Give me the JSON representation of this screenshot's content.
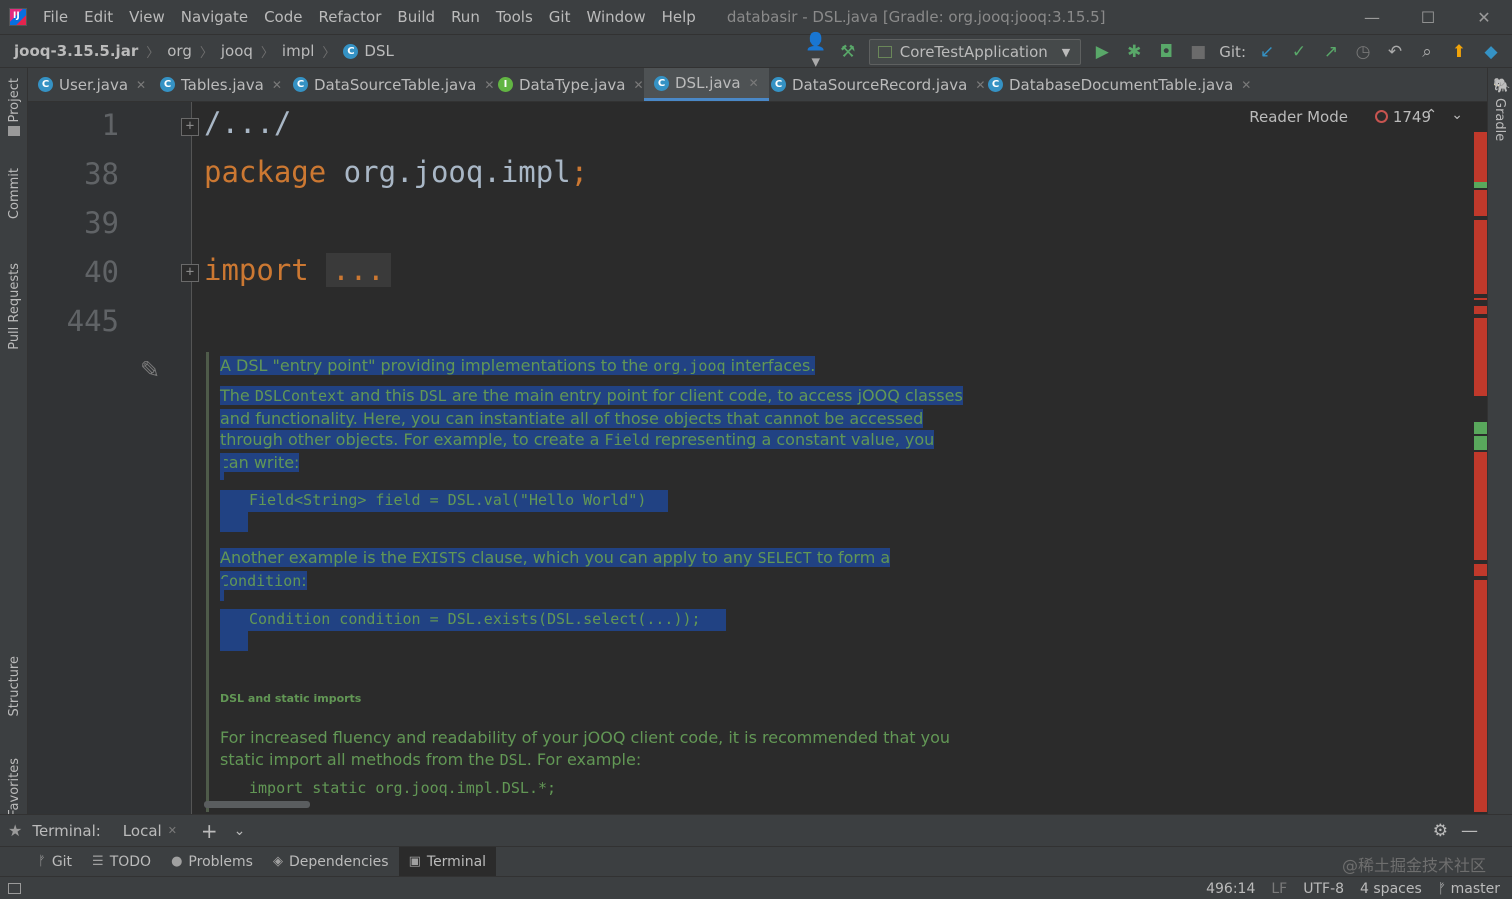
{
  "window": {
    "title": "databasir - DSL.java [Gradle: org.jooq:jooq:3.15.5]",
    "menu": [
      "File",
      "Edit",
      "View",
      "Navigate",
      "Code",
      "Refactor",
      "Build",
      "Run",
      "Tools",
      "Git",
      "Window",
      "Help"
    ],
    "controls": {
      "minimize": "—",
      "maximize": "☐",
      "close": "✕"
    }
  },
  "breadcrumbs": [
    "jooq-3.15.5.jar",
    "org",
    "jooq",
    "impl",
    "DSL"
  ],
  "toolbar": {
    "run_config": "CoreTestApplication",
    "git_label": "Git:"
  },
  "left_tool_windows": [
    "Project",
    "Commit",
    "Pull Requests",
    "Structure",
    "Favorites"
  ],
  "right_tool_windows": [
    "Gradle"
  ],
  "tabs": [
    {
      "label": "User.java",
      "badge": "C"
    },
    {
      "label": "Tables.java",
      "badge": "C"
    },
    {
      "label": "DataSourceTable.java",
      "badge": "C"
    },
    {
      "label": "DataType.java",
      "badge": "I"
    },
    {
      "label": "DSL.java",
      "badge": "C",
      "active": true
    },
    {
      "label": "DataSourceRecord.java",
      "badge": "C"
    },
    {
      "label": "DatabaseDocumentTable.java",
      "badge": "C"
    }
  ],
  "editor": {
    "reader_mode": "Reader Mode",
    "error_count": "1749",
    "line_numbers": [
      "1",
      "38",
      "39",
      "40",
      "445"
    ],
    "lines": {
      "l1": "/.../",
      "l38_kw": "package",
      "l38_rest": " org.jooq.impl",
      "l38_semi": ";",
      "l40_kw": "import",
      "l40_fold": "..."
    },
    "javadoc": {
      "p1_a": "A DSL \"entry point\" providing implementations to the ",
      "p1_code": "org.jooq",
      "p1_b": " interfaces.",
      "p2_a": "The ",
      "p2_code1": "DSLContext",
      "p2_b": " and this ",
      "p2_code2": "DSL",
      "p2_c": " are the main entry point for client code, to access jOOQ classes and functionality. Here, you can instantiate all of those objects that cannot be accessed through other objects. For example, to create a ",
      "p2_code3": "Field",
      "p2_d": " representing a constant value, you can write:",
      "code1": "Field<String> field = DSL.val(\"Hello World\")",
      "p3_a": "Another example is the ",
      "p3_code1": "EXISTS",
      "p3_b": " clause, which you can apply to any ",
      "p3_code2": "SELECT",
      "p3_c": " to form a ",
      "p3_code3": "Condition",
      "p3_d": ":",
      "code2": "Condition condition = DSL.exists(DSL.select(...));",
      "heading": "DSL and static imports",
      "p4_a": "For increased fluency and readability of your jOOQ client code, it is recommended that you static import all methods from the ",
      "p4_code": "DSL",
      "p4_b": ". For example:",
      "code3": "import static org.jooq.impl.DSL.*;"
    }
  },
  "terminal": {
    "label": "Terminal:",
    "session": "Local"
  },
  "tool_buttons": [
    "Git",
    "TODO",
    "Problems",
    "Dependencies",
    "Terminal"
  ],
  "watermark": "@稀土掘金技术社区",
  "status": {
    "position": "496:14",
    "line_sep": "LF",
    "encoding": "UTF-8",
    "indent": "4 spaces",
    "branch": "master"
  },
  "colors": {
    "background": "#2b2b2b",
    "panel": "#3c3f41",
    "keyword": "#cc7832",
    "doc_comment": "#629755",
    "selection": "#214283",
    "error_stripe": "#c0392b",
    "accent": "#4a88c7"
  }
}
